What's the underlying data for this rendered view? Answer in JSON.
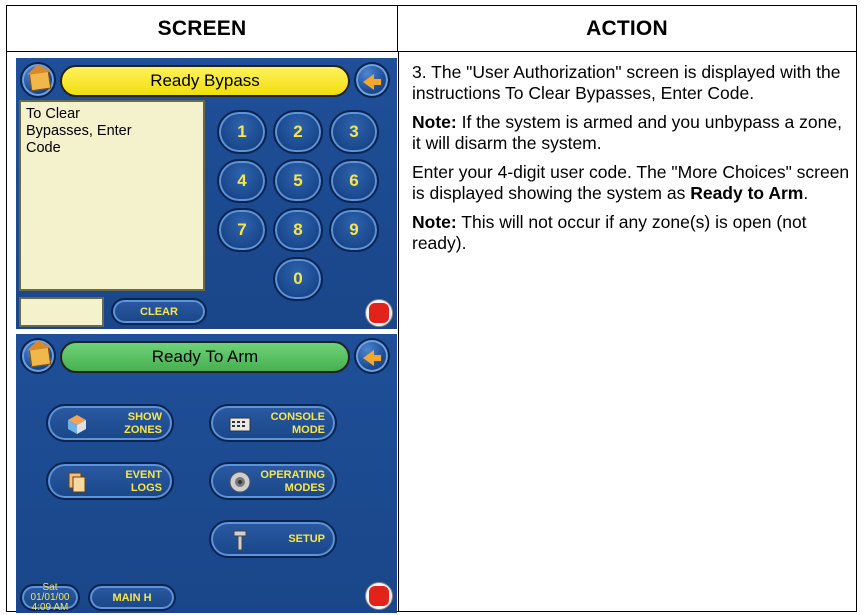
{
  "table": {
    "header_screen": "SCREEN",
    "header_action": "ACTION"
  },
  "screen1": {
    "title": "Ready Bypass",
    "title_color": "#f1de0c",
    "message_line1": "To Clear",
    "message_line2": "Bypasses, Enter",
    "message_line3": "Code",
    "keys": [
      "1",
      "2",
      "3",
      "4",
      "5",
      "6",
      "7",
      "8",
      "9",
      "0"
    ],
    "clear_label": "CLEAR"
  },
  "screen2": {
    "title": "Ready To Arm",
    "title_color": "#46b04f",
    "show_zones_1": "SHOW",
    "show_zones_2": "ZONES",
    "console_mode_1": "CONSOLE",
    "console_mode_2": "MODE",
    "event_logs_1": "EVENT",
    "event_logs_2": "LOGS",
    "operating_modes_1": "OPERATING",
    "operating_modes_2": "MODES",
    "setup_label": "SETUP",
    "date": "Sat 01/01/00",
    "time": "4:09 AM",
    "main_label": "MAIN H"
  },
  "action": {
    "p1": "3. The \"User Authorization\" screen is displayed with the instructions To Clear Bypasses, Enter Code.",
    "note_label": "Note:",
    "p2": "If the system is armed and you unbypass a zone, it will disarm the system.",
    "p3_a": "Enter your 4-digit user code. The \"More Choices\" screen is displayed showing the system as ",
    "p3_b": "Ready to Arm",
    "p3_c": ".",
    "note_label2": "Note:",
    "p4": "This will not occur if any zone(s) is open (not ready)."
  },
  "icons": [
    "home-icon",
    "back-arrow-icon",
    "panic-icon",
    "zones-icon",
    "console-keypad-icon",
    "event-logs-icon",
    "speaker-icon",
    "setup-tool-icon"
  ]
}
